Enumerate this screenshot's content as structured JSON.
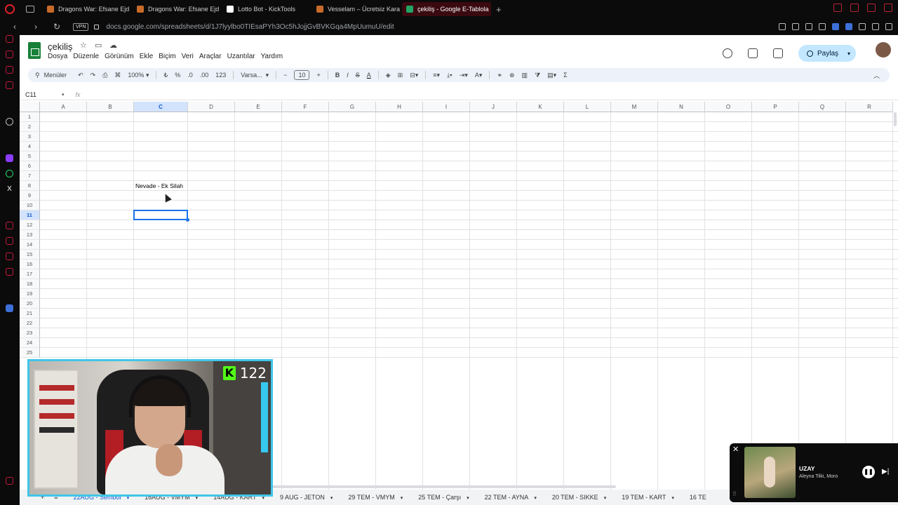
{
  "browser": {
    "tabs": [
      {
        "label": "Dragons War: Efsane Ejd",
        "fav": "dw"
      },
      {
        "label": "Dragons War: Efsane Ejd",
        "fav": "dw"
      },
      {
        "label": "Lotto Bot - KickTools",
        "fav": "kt"
      },
      {
        "label": "Vesselam – Ücretsiz Kara",
        "fav": "dw"
      },
      {
        "label": "çekiliş - Google E-Tablola",
        "fav": "gs",
        "active": true
      }
    ],
    "vpn_label": "VPN",
    "url": "docs.google.com/spreadsheets/d/1J7lyylbo0TIEsaPYh3Oc5hJojjGvBVKGqa4MpUumuU/edit"
  },
  "sheets": {
    "title": "çekiliş",
    "menus": [
      "Dosya",
      "Düzenle",
      "Görünüm",
      "Ekle",
      "Biçim",
      "Veri",
      "Araçlar",
      "Uzantılar",
      "Yardım"
    ],
    "share_label": "Paylaş",
    "toolbar": {
      "search_label": "Menüler",
      "zoom": "100%",
      "currency": "₺",
      "percent": "%",
      "dec_less": ".0",
      "dec_more": ".00",
      "number_format": "123",
      "font": "Varsa...",
      "font_size": "10",
      "minus": "−",
      "plus": "+",
      "bold": "B",
      "italic": "I",
      "strike": "S",
      "text_color": "A",
      "text_color_2": "A"
    },
    "name_box": "C11",
    "fx": "fx",
    "columns": [
      "A",
      "B",
      "C",
      "D",
      "E",
      "F",
      "G",
      "H",
      "I",
      "J",
      "K",
      "L",
      "M",
      "N",
      "O",
      "P",
      "Q",
      "R"
    ],
    "selected_column": "C",
    "rows": [
      "1",
      "2",
      "3",
      "4",
      "5",
      "6",
      "7",
      "8",
      "9",
      "10",
      "11",
      "12",
      "13",
      "14",
      "15",
      "16",
      "17",
      "18",
      "19",
      "20",
      "21",
      "22",
      "23",
      "24",
      "25"
    ],
    "selected_row": "11",
    "cells": [
      {
        "ref": "C8",
        "value": "Nevade - Ek Silah"
      }
    ],
    "sheet_tabs": [
      "22AUG - Sembol",
      "16AUG - VMYM",
      "14AUG - KART",
      "9 AUG - JETON",
      "29 TEM - VMYM",
      "25 TEM - Çarşı",
      "22 TEM - AYNA",
      "20 TEM - SIKKE",
      "19 TEM - KART",
      "16 TE"
    ]
  },
  "webcam": {
    "viewer_count": "122",
    "platform_mark": "K"
  },
  "music_player": {
    "title": "UZAY",
    "artist": "Aleyna Tilki, Moro"
  },
  "colors": {
    "accent": "#1a73e8",
    "share_bg": "#c2e7ff",
    "kick_green": "#53fc18",
    "webcam_border": "#3fc6e8"
  }
}
